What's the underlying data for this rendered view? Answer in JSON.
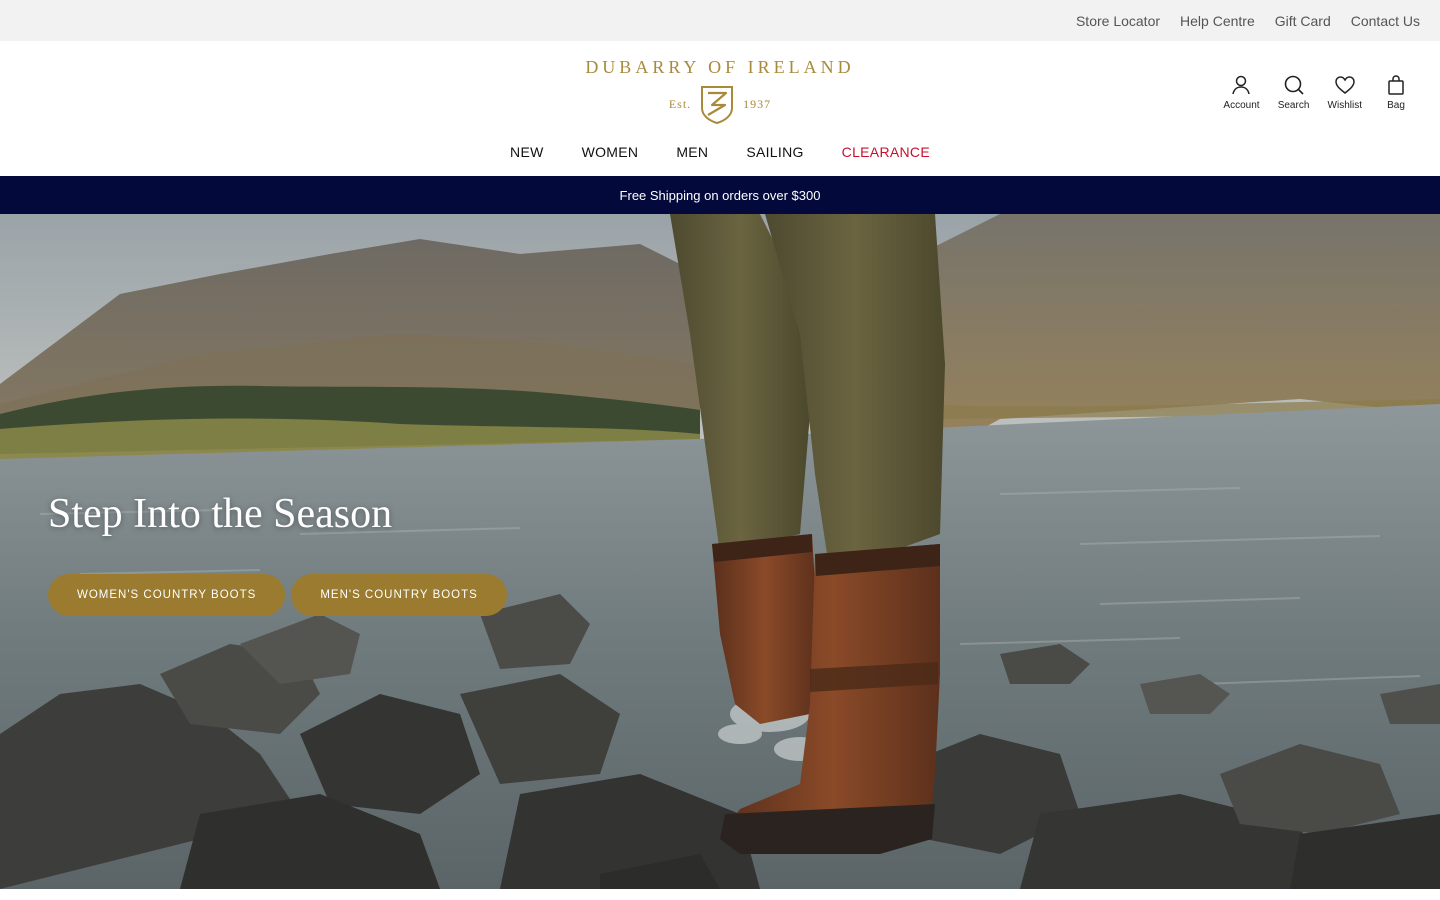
{
  "utility_bar": {
    "links": [
      "Store Locator",
      "Help Centre",
      "Gift Card",
      "Contact Us"
    ]
  },
  "logo": {
    "wordmark": "DUBARRY OF IRELAND",
    "est": "Est.",
    "year": "1937"
  },
  "header_icons": {
    "account": "Account",
    "search": "Search",
    "wishlist": "Wishlist",
    "bag": "Bag"
  },
  "nav": {
    "items": [
      "NEW",
      "WOMEN",
      "MEN",
      "SAILING",
      "CLEARANCE"
    ]
  },
  "promo": {
    "text": "Free Shipping on orders over $300"
  },
  "hero": {
    "title": "Step Into the Season",
    "buttons": [
      "WOMEN'S COUNTRY BOOTS",
      "MEN'S COUNTRY BOOTS"
    ]
  },
  "colors": {
    "brand_gold": "#a88a3a",
    "button_gold": "#9a7b2f",
    "promo_navy": "#03093b",
    "clearance_red": "#c8102e"
  }
}
